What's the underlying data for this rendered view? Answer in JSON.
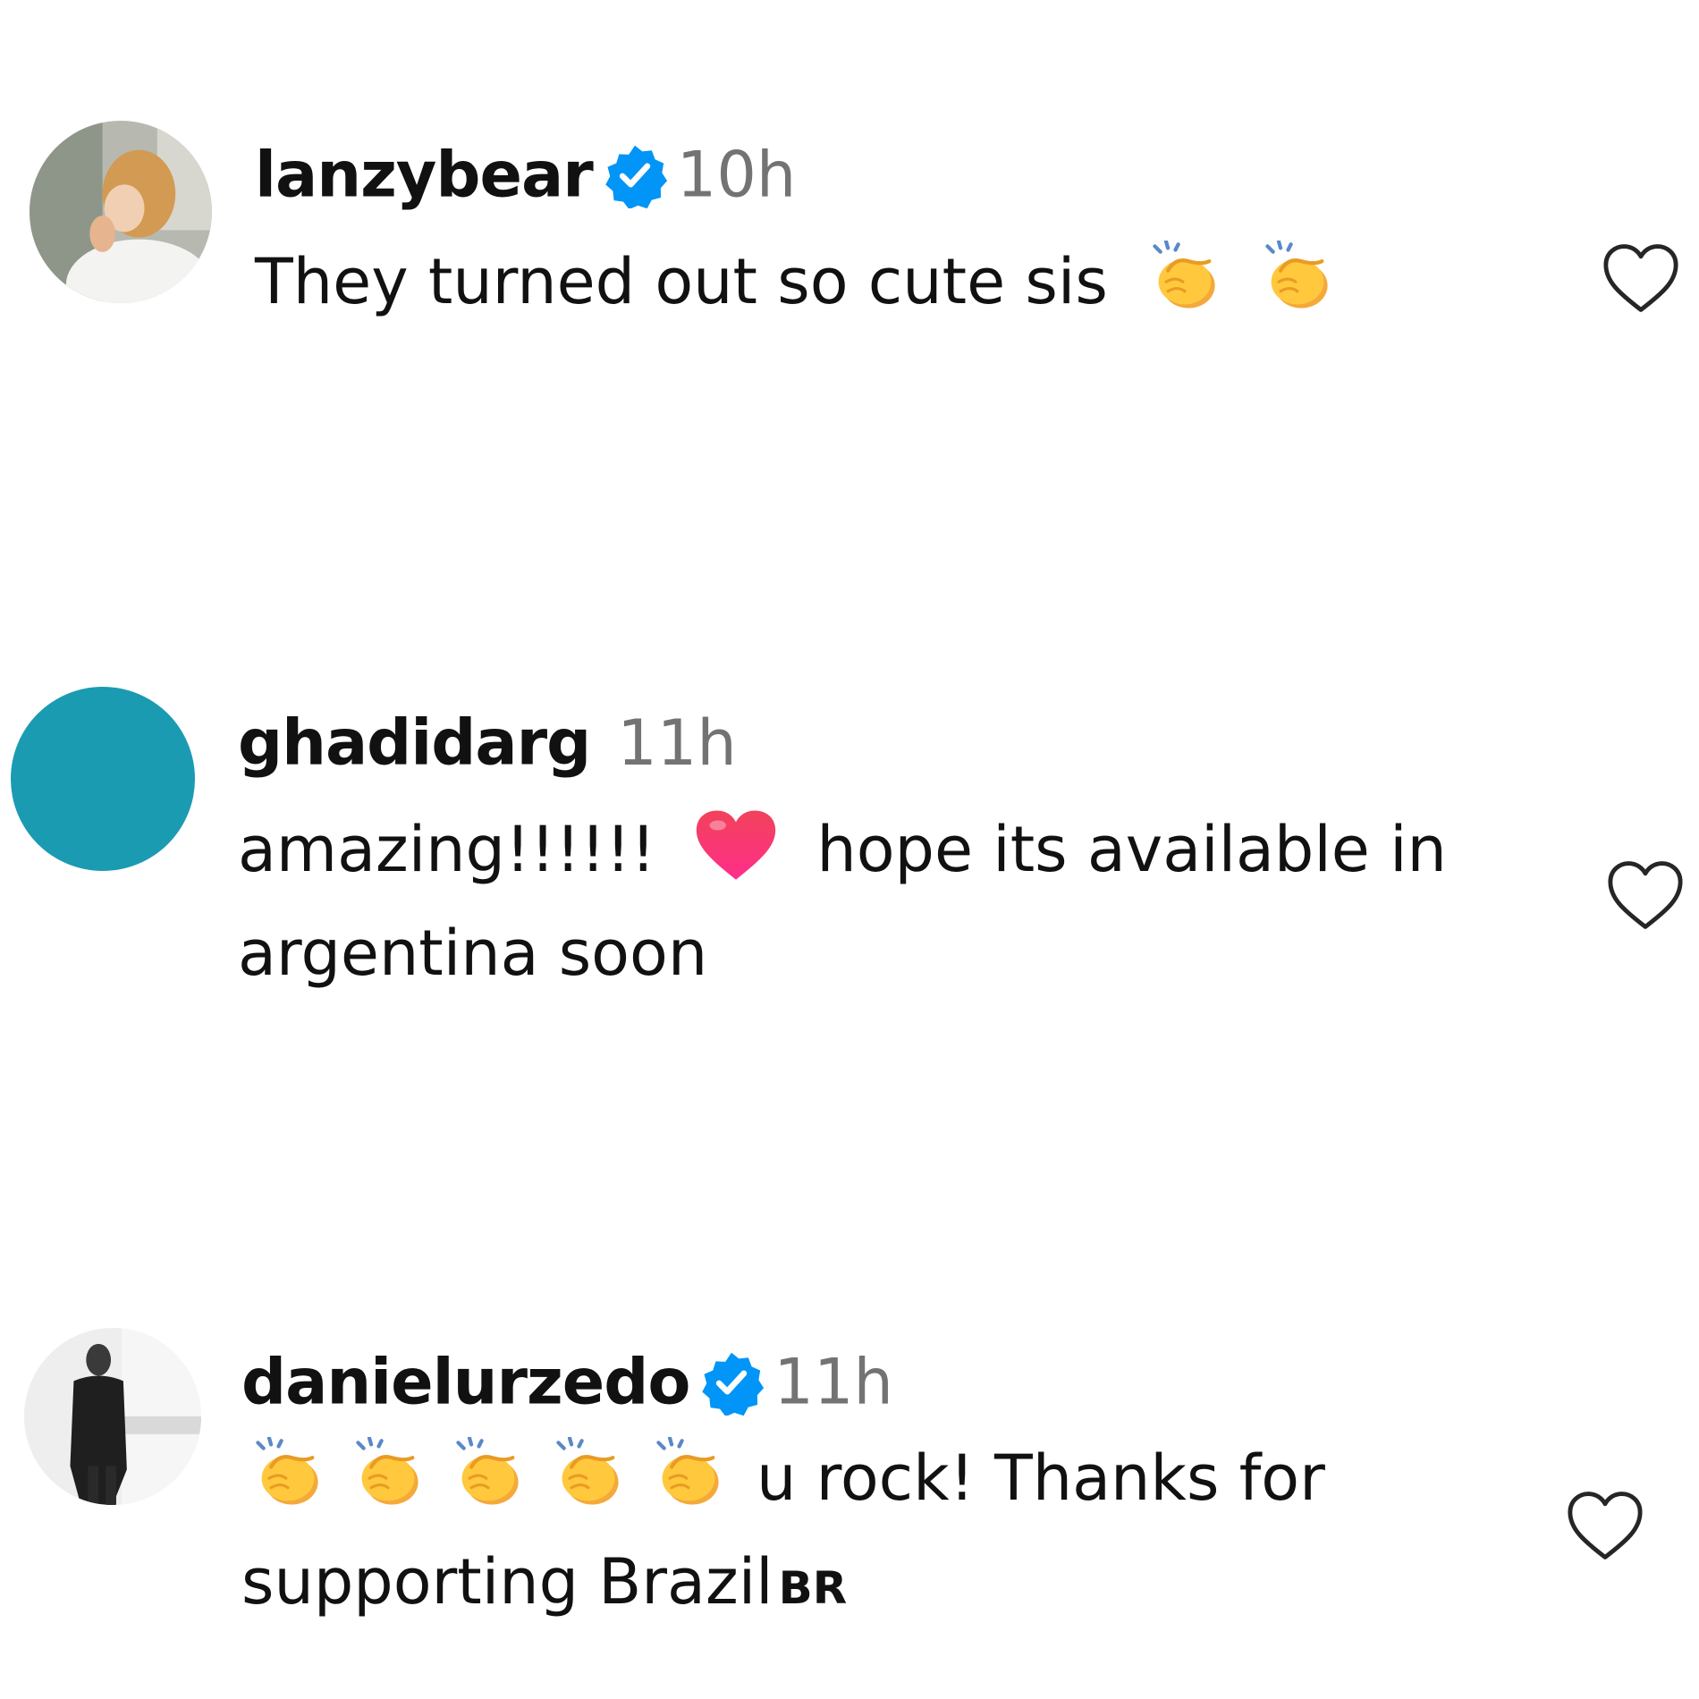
{
  "comments": [
    {
      "username": "lanzybear",
      "verified": true,
      "time": "10h",
      "text_parts": [
        "They turned out so cute sis"
      ],
      "emojis": [
        "clapping-hands",
        "clapping-hands"
      ]
    },
    {
      "username": "ghadidarg",
      "verified": false,
      "time": "11h",
      "avatar_color": "#1A9BB2",
      "text_parts": [
        "amazing!!!!!!",
        "hope its available in",
        "argentina soon"
      ],
      "emojis": [
        "red-heart"
      ]
    },
    {
      "username": "danielurzedo",
      "verified": true,
      "time": "11h",
      "text_parts": [
        "u rock! Thanks for",
        "supporting Brazil",
        "BR"
      ],
      "emojis": [
        "clapping-hands",
        "clapping-hands",
        "clapping-hands",
        "clapping-hands",
        "clapping-hands"
      ]
    }
  ],
  "colors": {
    "verified_badge": "#0095F6",
    "timestamp": "#737373",
    "text": "#111111"
  }
}
